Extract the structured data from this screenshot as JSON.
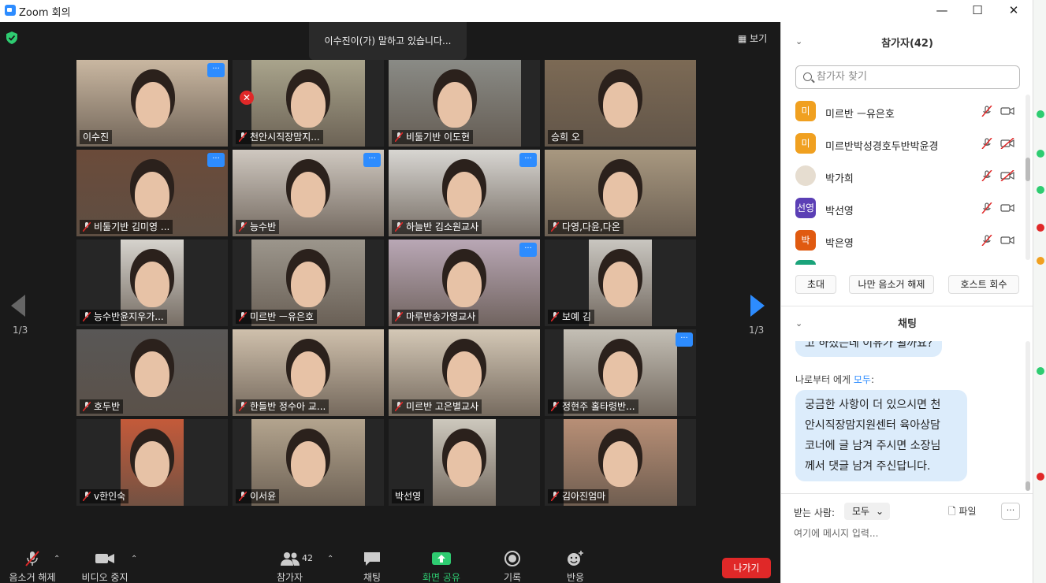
{
  "window": {
    "title": "Zoom 회의"
  },
  "meeting": {
    "speaking_banner": "이수진이(가) 말하고 있습니다...",
    "view_label": "보기",
    "page_left": "1/3",
    "page_right": "1/3",
    "tiles": [
      {
        "name": "이수진",
        "muted": false,
        "more": true,
        "active": true,
        "bg": "#d9cfc0",
        "photo": "#c9b7a1"
      },
      {
        "name": "천안시직장맘지...",
        "muted": true,
        "more": false,
        "bg": "#262626",
        "photo": "#a9a48c"
      },
      {
        "name": "비둘기반 이도현",
        "muted": true,
        "more": false,
        "bg": "#262626",
        "photo": "#8a8b86"
      },
      {
        "name": "승희 오",
        "muted": false,
        "more": false,
        "bg": "#262626",
        "photo": "#7c6a55"
      },
      {
        "name": "비둘기반 김미영 ...",
        "muted": true,
        "more": true,
        "bg": "#262626",
        "photo": "#6b4b3a"
      },
      {
        "name": "능수반",
        "muted": true,
        "more": true,
        "bg": "#262626",
        "photo": "#cfc8c0"
      },
      {
        "name": "하늘반 김소원교사",
        "muted": true,
        "more": true,
        "bg": "#262626",
        "photo": "#d8d6d2"
      },
      {
        "name": "다영,다윤,다온",
        "muted": true,
        "more": false,
        "bg": "#262626",
        "photo": "#a89880"
      },
      {
        "name": "능수반윤지우가...",
        "muted": true,
        "more": false,
        "bg": "#262626",
        "photo": "#d6d3cd"
      },
      {
        "name": "미르반 ㅡ유은호",
        "muted": true,
        "more": false,
        "bg": "#262626",
        "photo": "#9c968c"
      },
      {
        "name": "마루반송가영교사",
        "muted": true,
        "more": true,
        "bg": "#262626",
        "photo": "#b9a7b5"
      },
      {
        "name": "보예 김",
        "muted": true,
        "more": false,
        "bg": "#262626",
        "photo": "#c9c6c0"
      },
      {
        "name": "호두반",
        "muted": true,
        "more": false,
        "bg": "#262626",
        "photo": "#595756"
      },
      {
        "name": "한들반 정수아 교...",
        "muted": true,
        "more": false,
        "bg": "#262626",
        "photo": "#cfc0ac"
      },
      {
        "name": "미르반 고은별교사",
        "muted": true,
        "more": false,
        "bg": "#262626",
        "photo": "#d4c8b6"
      },
      {
        "name": "정현주 홀타령반...",
        "muted": true,
        "more": true,
        "bg": "#262626",
        "photo": "#c4bfb5"
      },
      {
        "name": "v한인숙",
        "muted": true,
        "more": false,
        "bg": "#262626",
        "photo": "#c45a3a"
      },
      {
        "name": "이서윤",
        "muted": true,
        "more": false,
        "bg": "#262626",
        "photo": "#b3a48e"
      },
      {
        "name": "박선영",
        "muted": false,
        "more": false,
        "bg": "#262626",
        "photo": "#cdc8bd"
      },
      {
        "name": "김아진엄마",
        "muted": true,
        "more": false,
        "bg": "#262626",
        "photo": "#b88f76"
      }
    ]
  },
  "toolbar": {
    "mute_label": "음소거 해제",
    "video_label": "비디오 중지",
    "participants_label": "참가자",
    "participants_count": "42",
    "chat_label": "채팅",
    "share_label": "화면 공유",
    "record_label": "기록",
    "reaction_label": "반응",
    "leave_label": "나가기",
    "colors": {
      "share": "#2ecc71",
      "leave": "#e02828",
      "accent": "#2D8CFF"
    }
  },
  "participants_panel": {
    "title": "참가자(42)",
    "search_placeholder": "참가자 찾기",
    "list": [
      {
        "avatar_text": "미",
        "avatar_color": "#f0a020",
        "name": "미르반 ㅡ유은호",
        "mic": "muted",
        "cam": "on"
      },
      {
        "avatar_text": "미",
        "avatar_color": "#f0a020",
        "name": "미르반박성경호두반박윤경",
        "mic": "muted",
        "cam": "off"
      },
      {
        "avatar_text": "",
        "avatar_color": "#d9d2c4",
        "name": "박가희",
        "mic": "muted",
        "cam": "off"
      },
      {
        "avatar_text": "선영",
        "avatar_color": "#5b3fb5",
        "name": "박선영",
        "mic": "muted",
        "cam": "on"
      },
      {
        "avatar_text": "박",
        "avatar_color": "#e05a10",
        "name": "박은영",
        "mic": "muted",
        "cam": "on"
      }
    ],
    "invite_label": "초대",
    "unmute_me_label": "나만 음소거 해제",
    "reclaim_host_label": "호스트 회수"
  },
  "chat_panel": {
    "title": "채팅",
    "prev_fragment": "고 하셨는데 이유가 될까요?",
    "from_prefix": "나로부터 에게",
    "from_to": "모두",
    "message": "궁금한 사항이 더 있으시면 천안시직장맘지원센터 육아상담코너에 글 남겨 주시면 소장님께서 댓글 남겨 주신답니다.",
    "message_lines": [
      "궁금한 사항이 더 있으시면 천",
      "안시직장맘지원센터 육아상담",
      "코너에 글 남겨 주시면 소장님",
      "께서 댓글 남겨 주신답니다."
    ],
    "to_label": "받는 사람:",
    "to_value": "모두",
    "file_label": "파일",
    "more_label": "···",
    "input_placeholder": "여기에 메시지 입력..."
  }
}
